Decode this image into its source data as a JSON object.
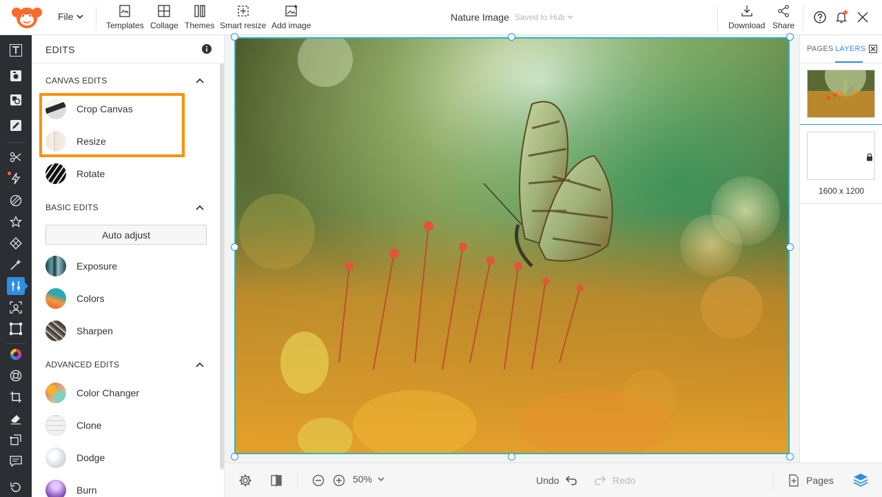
{
  "topbar": {
    "file_label": "File",
    "tools": [
      {
        "label": "Templates",
        "icon": "templates-icon"
      },
      {
        "label": "Collage",
        "icon": "collage-icon"
      },
      {
        "label": "Themes",
        "icon": "themes-icon"
      },
      {
        "label": "Smart resize",
        "icon": "smart-resize-icon"
      },
      {
        "label": "Add image",
        "icon": "add-image-icon"
      }
    ],
    "document_title": "Nature Image",
    "save_status": "Saved to Hub",
    "download_label": "Download",
    "share_label": "Share"
  },
  "rail": {
    "icons": [
      "text-icon",
      "camera-icon",
      "shapes-icon",
      "draw-icon",
      "cut-icon",
      "effects-icon",
      "texture-icon",
      "sticker-icon",
      "pattern-icon",
      "retouch-icon",
      "adjust-icon",
      "face-icon",
      "frame-icon",
      "color-wheel-icon",
      "lens-icon",
      "crop-icon",
      "eraser-icon",
      "transform-icon",
      "comment-icon",
      "history-icon"
    ],
    "active": "adjust-icon",
    "accent": "#2e8ee4"
  },
  "edits": {
    "title": "EDITS",
    "canvas_section": "CANVAS EDITS",
    "canvas_items": [
      "Crop Canvas",
      "Resize",
      "Rotate"
    ],
    "basic_section": "BASIC EDITS",
    "auto_adjust": "Auto adjust",
    "basic_items": [
      "Exposure",
      "Colors",
      "Sharpen"
    ],
    "advanced_section": "ADVANCED EDITS",
    "advanced_items": [
      "Color Changer",
      "Clone",
      "Dodge",
      "Burn"
    ],
    "highlight_color": "#ff9100"
  },
  "bottombar": {
    "zoom": "50%",
    "undo": "Undo",
    "redo": "Redo",
    "pages": "Pages"
  },
  "right_panel": {
    "tab_pages": "PAGES",
    "tab_layers": "LAYERS",
    "dimensions": "1600 x 1200"
  }
}
